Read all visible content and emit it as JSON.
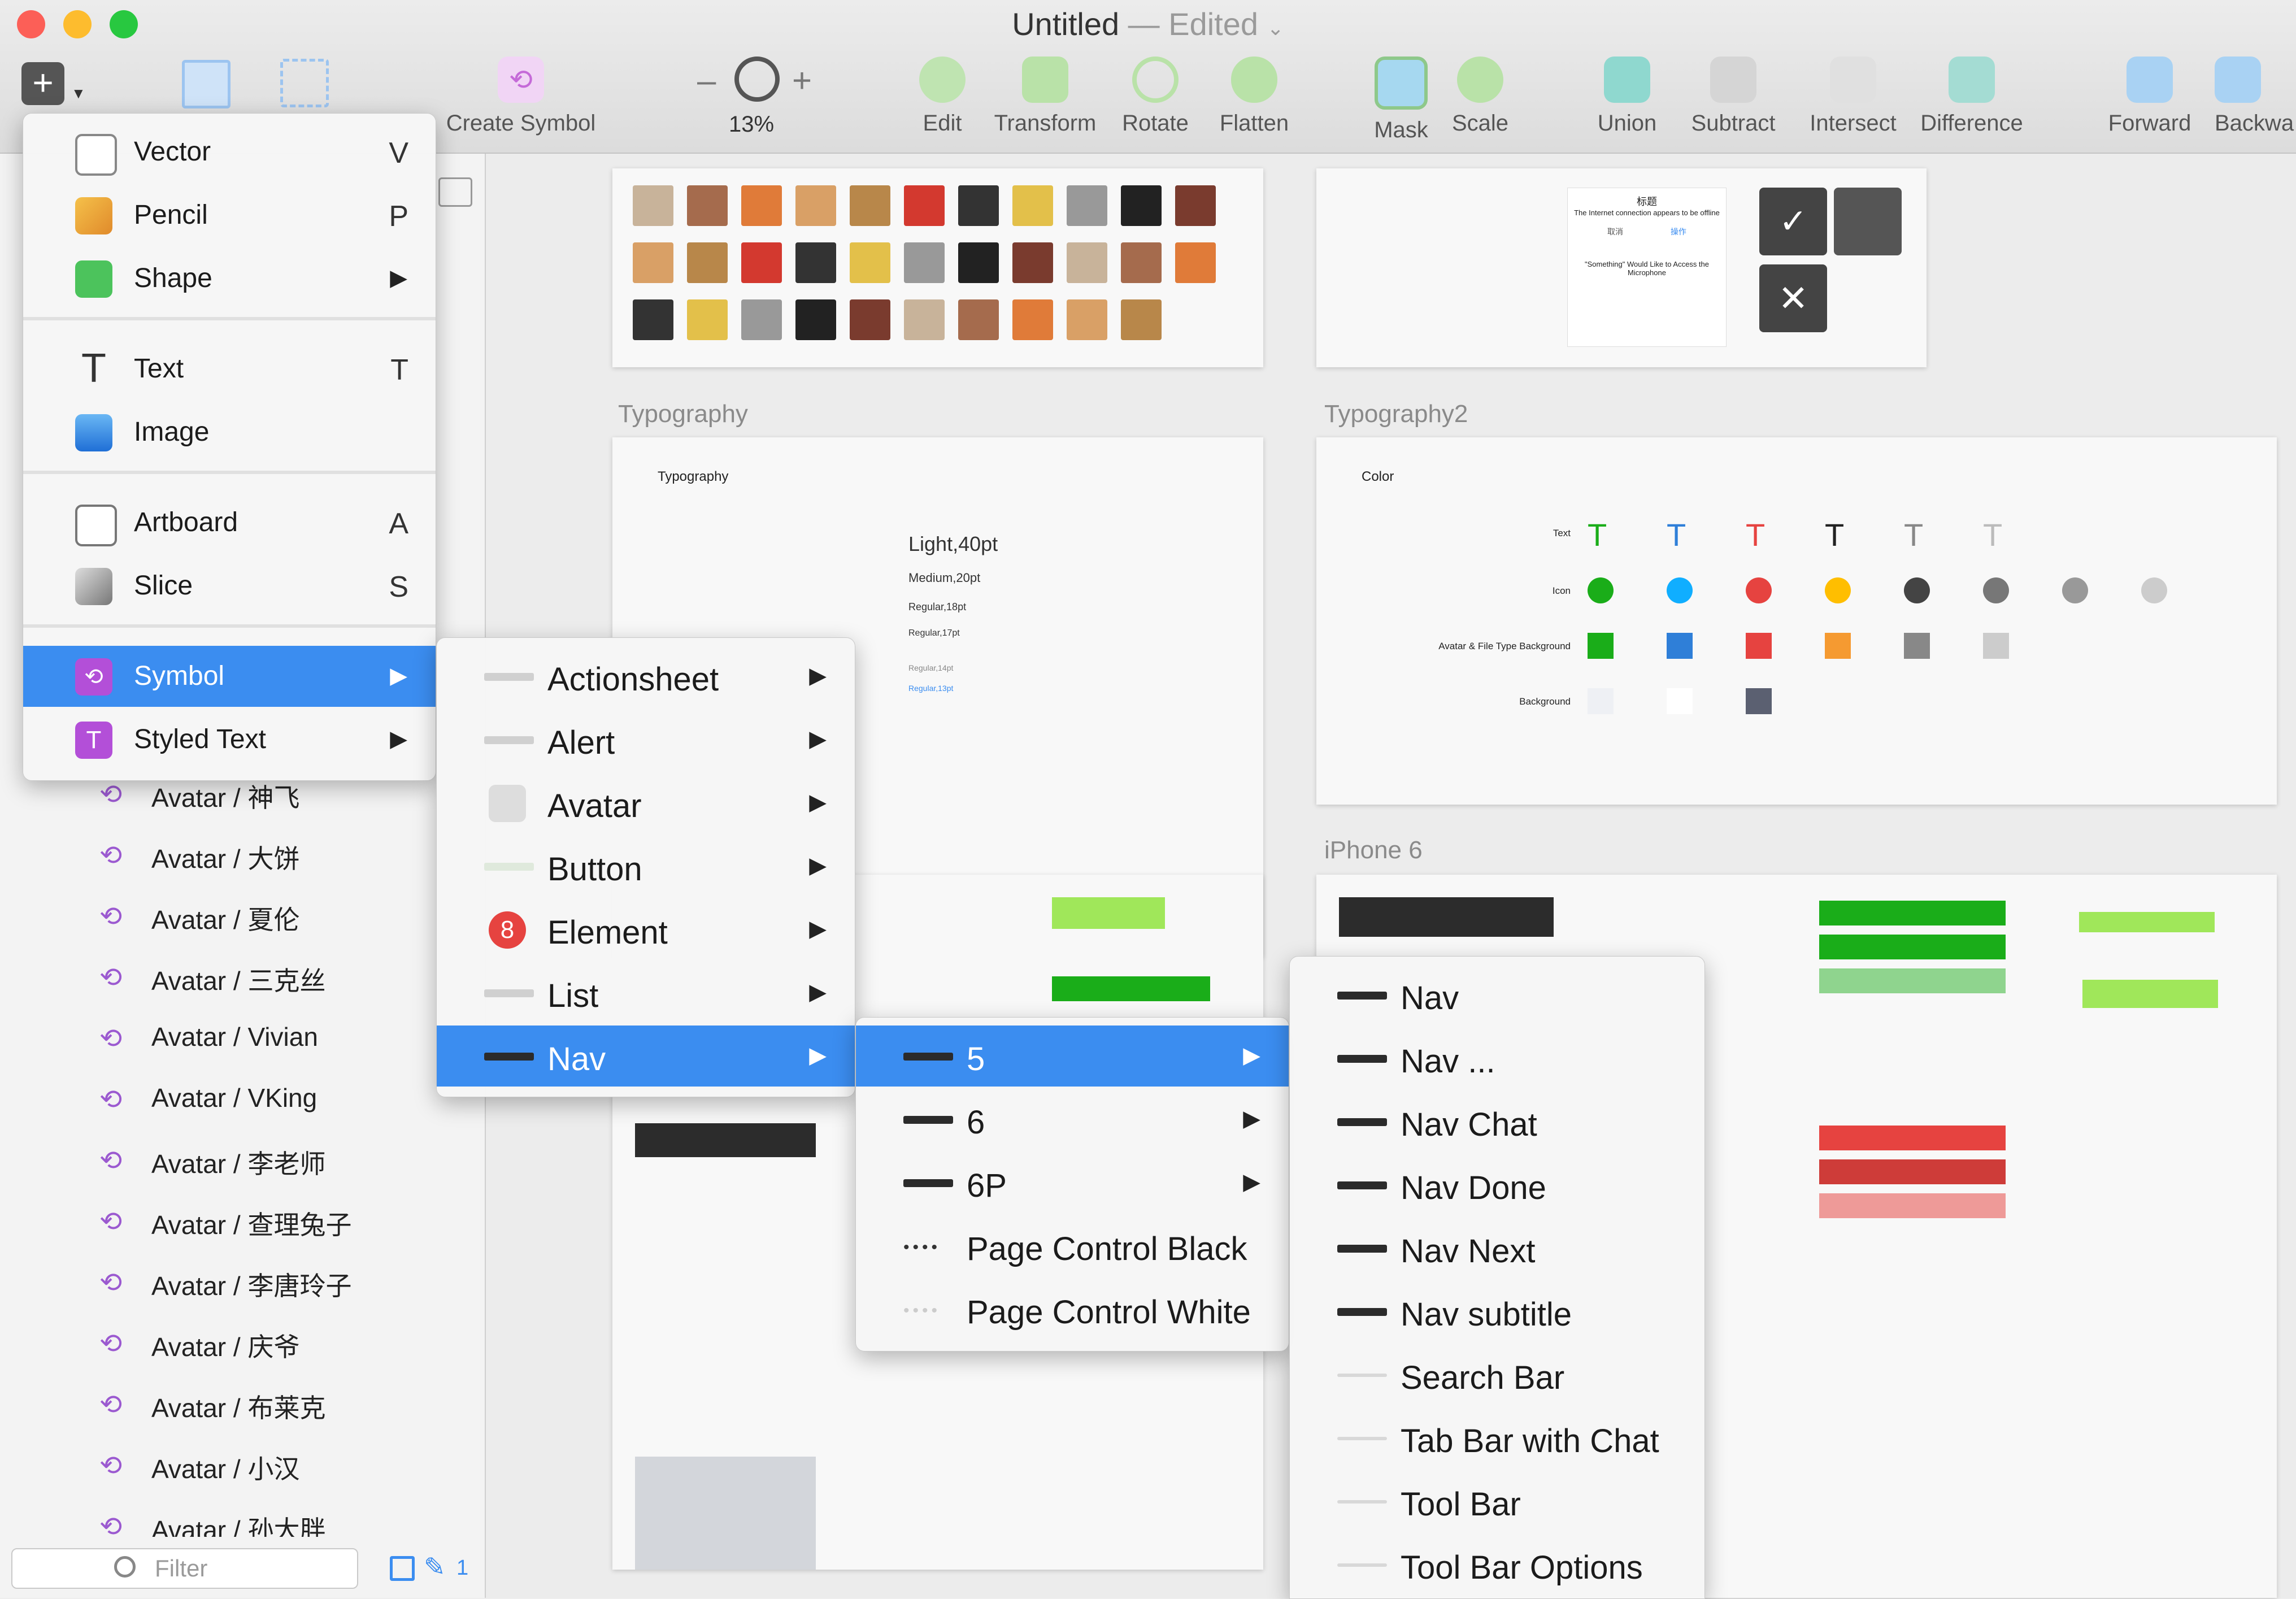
{
  "window": {
    "title": "Untitled",
    "separator": "—",
    "status": "Edited"
  },
  "toolbar": {
    "zoom": {
      "minus": "–",
      "plus": "+",
      "value": "13%"
    },
    "items": [
      {
        "label": "Create Symbol",
        "icon": "symbol-icon"
      },
      {
        "label": "Edit",
        "icon": "edit-icon"
      },
      {
        "label": "Transform",
        "icon": "transform-icon"
      },
      {
        "label": "Rotate",
        "icon": "rotate-icon"
      },
      {
        "label": "Flatten",
        "icon": "flatten-icon"
      },
      {
        "label": "Mask",
        "icon": "mask-icon"
      },
      {
        "label": "Scale",
        "icon": "scale-icon"
      },
      {
        "label": "Union",
        "icon": "union-icon"
      },
      {
        "label": "Subtract",
        "icon": "subtract-icon"
      },
      {
        "label": "Intersect",
        "icon": "intersect-icon"
      },
      {
        "label": "Difference",
        "icon": "difference-icon"
      },
      {
        "label": "Forward",
        "icon": "forward-icon"
      },
      {
        "label": "Backwa",
        "icon": "backward-icon"
      }
    ]
  },
  "insert_menu": {
    "items": [
      {
        "label": "Vector",
        "shortcut": "V"
      },
      {
        "label": "Pencil",
        "shortcut": "P"
      },
      {
        "label": "Shape",
        "shortcut": ""
      },
      {
        "label": "Text",
        "shortcut": "T"
      },
      {
        "label": "Image",
        "shortcut": ""
      },
      {
        "label": "Artboard",
        "shortcut": "A"
      },
      {
        "label": "Slice",
        "shortcut": "S"
      },
      {
        "label": "Symbol",
        "shortcut": ""
      },
      {
        "label": "Styled Text",
        "shortcut": ""
      }
    ]
  },
  "symbol_menu": {
    "items": [
      "Actionsheet",
      "Alert",
      "Avatar",
      "Button",
      "Element",
      "List",
      "Nav"
    ],
    "element_badge": "8"
  },
  "nav_menu": {
    "items": [
      "5",
      "6",
      "6P",
      "Page Control Black",
      "Page Control White"
    ]
  },
  "nav5_menu": {
    "items": [
      "Nav",
      "Nav ...",
      "Nav Chat",
      "Nav Done",
      "Nav Next",
      "Nav subtitle",
      "Search Bar",
      "Tab Bar with Chat",
      "Tool Bar",
      "Tool Bar Options"
    ]
  },
  "layers": [
    "Avatar / 神飞",
    "Avatar / 大饼",
    "Avatar / 夏伦",
    "Avatar / 三克丝",
    "Avatar / Vivian",
    "Avatar / VKing",
    "Avatar / 李老师",
    "Avatar / 查理兔子",
    "Avatar / 李唐玲子",
    "Avatar / 庆爷",
    "Avatar / 布莱克",
    "Avatar / 小汉",
    "Avatar / 孙大胖"
  ],
  "filter": {
    "placeholder": "Filter",
    "count": "1"
  },
  "artboards": {
    "typography": {
      "label": "Typography",
      "heading": "Typography",
      "light": "Light,40pt",
      "medium": "Medium,20pt",
      "regular18": "Regular,18pt",
      "regular17": "Regular,17pt",
      "regular14": "Regular,14pt",
      "regular13": "Regular,13pt"
    },
    "typography2": {
      "label": "Typography2",
      "heading": "Color",
      "rows": [
        "Text",
        "Icon",
        "Avatar & File Type Background",
        "Background"
      ]
    },
    "iphone6": {
      "label": "iPhone 6"
    },
    "alert": {
      "title": "标题",
      "message": "The Internet connection appears to be offline",
      "cancel": "取消",
      "ok": "操作",
      "mic": "\"Something\" Would Like to Access the Microphone"
    }
  },
  "colors": {
    "accent": "#3b8df0",
    "symbol": "#b34fd8",
    "green": "#1aad19",
    "red": "#e64340",
    "blue": "#10aeff",
    "yellow": "#ffbe00"
  }
}
